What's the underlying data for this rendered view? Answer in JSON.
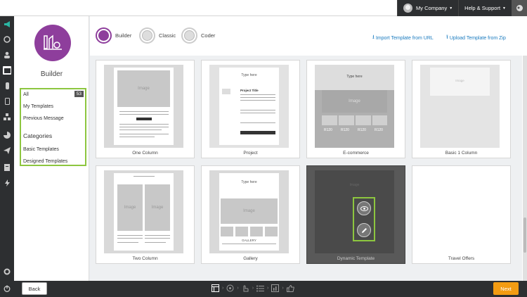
{
  "topbar": {
    "company_label": "My Company",
    "help_label": "Help & Support"
  },
  "leftnav": {
    "icons": [
      "campaign-icon",
      "dashboard-icon",
      "contacts-icon",
      "email-icon",
      "mobile-icon",
      "sms-icon",
      "automation-icon",
      "segments-icon",
      "social-icon",
      "send-icon",
      "reports-icon",
      "integrations-icon",
      "settings-icon",
      "power-icon"
    ]
  },
  "sidebar": {
    "title": "Builder",
    "filters": {
      "all_label": "All",
      "all_count": "53",
      "my_templates": "My Templates",
      "previous_message": "Previous Message",
      "categories_heading": "Categories",
      "basic_templates": "Basic Templates",
      "designed_templates": "Designed Templates"
    }
  },
  "editors": [
    {
      "label": "Builder",
      "active": true
    },
    {
      "label": "Classic",
      "active": false
    },
    {
      "label": "Coder",
      "active": false
    }
  ],
  "links": {
    "import_url": "Import Template from URL",
    "upload_zip": "Upload Template from Zip"
  },
  "templates": [
    {
      "name": "One Column"
    },
    {
      "name": "Project"
    },
    {
      "name": "E-commerce"
    },
    {
      "name": "Basic 1 Column"
    },
    {
      "name": "Two Column"
    },
    {
      "name": "Gallery"
    },
    {
      "name": "Dynamic Template"
    },
    {
      "name": "Travel Offers"
    }
  ],
  "thumb_text": {
    "image": "Image",
    "type_here": "Type here",
    "project_title": "Project Title",
    "gallery": "GALLERY",
    "price": "R120"
  },
  "bottombar": {
    "back_label": "Back",
    "next_label": "Next"
  },
  "colors": {
    "brand_purple": "#8e3e9c",
    "highlight_green": "#8dc63f",
    "next_orange": "#f39c12",
    "link_blue": "#1a7bbf",
    "chrome_dark": "#2d2f31"
  }
}
